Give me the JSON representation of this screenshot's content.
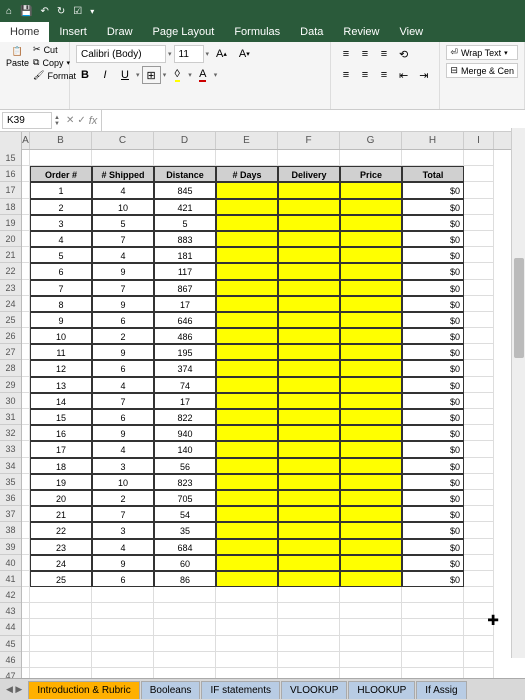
{
  "titlebar": {
    "qat": [
      "home",
      "save",
      "undo",
      "redo",
      "touch"
    ]
  },
  "tabs": [
    "Home",
    "Insert",
    "Draw",
    "Page Layout",
    "Formulas",
    "Data",
    "Review",
    "View"
  ],
  "active_tab": "Home",
  "clipboard": {
    "paste": "Paste",
    "cut": "Cut",
    "copy": "Copy",
    "format": "Format"
  },
  "font": {
    "name": "Calibri (Body)",
    "size": "11",
    "bold": "B",
    "italic": "I",
    "underline": "U",
    "grow": "A",
    "shrink": "A"
  },
  "alignment": {
    "wrap": "Wrap Text",
    "merge": "Merge & Cen"
  },
  "namebox": "K39",
  "fx": "fx",
  "col_headers": [
    "A",
    "B",
    "C",
    "D",
    "E",
    "F",
    "G",
    "H",
    "I"
  ],
  "row_start": 15,
  "row_end": 47,
  "table": {
    "headers": [
      "Order #",
      "# Shipped",
      "Distance",
      "# Days",
      "Delivery",
      "Price",
      "Total"
    ],
    "rows": [
      {
        "order": "1",
        "shipped": "4",
        "distance": "845",
        "days": "",
        "delivery": "",
        "price": "",
        "total": "$0"
      },
      {
        "order": "2",
        "shipped": "10",
        "distance": "421",
        "days": "",
        "delivery": "",
        "price": "",
        "total": "$0"
      },
      {
        "order": "3",
        "shipped": "5",
        "distance": "5",
        "days": "",
        "delivery": "",
        "price": "",
        "total": "$0"
      },
      {
        "order": "4",
        "shipped": "7",
        "distance": "883",
        "days": "",
        "delivery": "",
        "price": "",
        "total": "$0"
      },
      {
        "order": "5",
        "shipped": "4",
        "distance": "181",
        "days": "",
        "delivery": "",
        "price": "",
        "total": "$0"
      },
      {
        "order": "6",
        "shipped": "9",
        "distance": "117",
        "days": "",
        "delivery": "",
        "price": "",
        "total": "$0"
      },
      {
        "order": "7",
        "shipped": "7",
        "distance": "867",
        "days": "",
        "delivery": "",
        "price": "",
        "total": "$0"
      },
      {
        "order": "8",
        "shipped": "9",
        "distance": "17",
        "days": "",
        "delivery": "",
        "price": "",
        "total": "$0"
      },
      {
        "order": "9",
        "shipped": "6",
        "distance": "646",
        "days": "",
        "delivery": "",
        "price": "",
        "total": "$0"
      },
      {
        "order": "10",
        "shipped": "2",
        "distance": "486",
        "days": "",
        "delivery": "",
        "price": "",
        "total": "$0"
      },
      {
        "order": "11",
        "shipped": "9",
        "distance": "195",
        "days": "",
        "delivery": "",
        "price": "",
        "total": "$0"
      },
      {
        "order": "12",
        "shipped": "6",
        "distance": "374",
        "days": "",
        "delivery": "",
        "price": "",
        "total": "$0"
      },
      {
        "order": "13",
        "shipped": "4",
        "distance": "74",
        "days": "",
        "delivery": "",
        "price": "",
        "total": "$0"
      },
      {
        "order": "14",
        "shipped": "7",
        "distance": "17",
        "days": "",
        "delivery": "",
        "price": "",
        "total": "$0"
      },
      {
        "order": "15",
        "shipped": "6",
        "distance": "822",
        "days": "",
        "delivery": "",
        "price": "",
        "total": "$0"
      },
      {
        "order": "16",
        "shipped": "9",
        "distance": "940",
        "days": "",
        "delivery": "",
        "price": "",
        "total": "$0"
      },
      {
        "order": "17",
        "shipped": "4",
        "distance": "140",
        "days": "",
        "delivery": "",
        "price": "",
        "total": "$0"
      },
      {
        "order": "18",
        "shipped": "3",
        "distance": "56",
        "days": "",
        "delivery": "",
        "price": "",
        "total": "$0"
      },
      {
        "order": "19",
        "shipped": "10",
        "distance": "823",
        "days": "",
        "delivery": "",
        "price": "",
        "total": "$0"
      },
      {
        "order": "20",
        "shipped": "2",
        "distance": "705",
        "days": "",
        "delivery": "",
        "price": "",
        "total": "$0"
      },
      {
        "order": "21",
        "shipped": "7",
        "distance": "54",
        "days": "",
        "delivery": "",
        "price": "",
        "total": "$0"
      },
      {
        "order": "22",
        "shipped": "3",
        "distance": "35",
        "days": "",
        "delivery": "",
        "price": "",
        "total": "$0"
      },
      {
        "order": "23",
        "shipped": "4",
        "distance": "684",
        "days": "",
        "delivery": "",
        "price": "",
        "total": "$0"
      },
      {
        "order": "24",
        "shipped": "9",
        "distance": "60",
        "days": "",
        "delivery": "",
        "price": "",
        "total": "$0"
      },
      {
        "order": "25",
        "shipped": "6",
        "distance": "86",
        "days": "",
        "delivery": "",
        "price": "",
        "total": "$0"
      }
    ]
  },
  "sheet_tabs": [
    "Introduction & Rubric",
    "Booleans",
    "IF statements",
    "VLOOKUP",
    "HLOOKUP",
    "If Assig"
  ]
}
